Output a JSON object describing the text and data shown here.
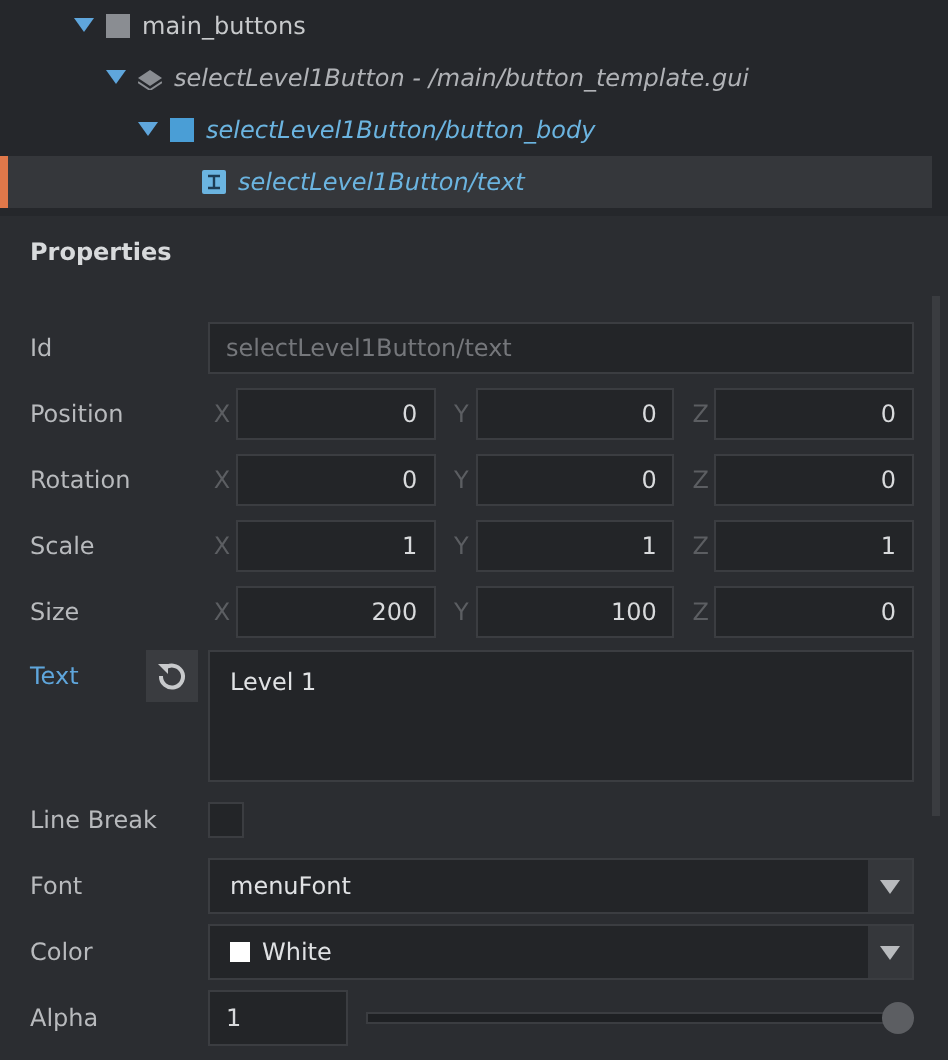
{
  "outline": [
    {
      "label": "main_buttons",
      "kind": "box",
      "expanded": true,
      "selected": false,
      "children": [
        {
          "label": "selectLevel1Button - /main/button_template.gui",
          "kind": "template",
          "expanded": true,
          "selected": false,
          "children": [
            {
              "label": "selectLevel1Button/button_body",
              "kind": "body",
              "expanded": true,
              "selected": false,
              "children": [
                {
                  "label": "selectLevel1Button/text",
                  "kind": "text",
                  "selected": true
                }
              ]
            }
          ]
        }
      ]
    }
  ],
  "properties": {
    "title": "Properties",
    "rows": [
      {
        "kind": "text",
        "label": "Id",
        "value": "selectLevel1Button/text",
        "disabled": true
      },
      {
        "kind": "vec3",
        "label": "Position",
        "axes": [
          {
            "axis": "X",
            "value": "0"
          },
          {
            "axis": "Y",
            "value": "0"
          },
          {
            "axis": "Z",
            "value": "0"
          }
        ]
      },
      {
        "kind": "vec3",
        "label": "Rotation",
        "axes": [
          {
            "axis": "X",
            "value": "0"
          },
          {
            "axis": "Y",
            "value": "0"
          },
          {
            "axis": "Z",
            "value": "0"
          }
        ]
      },
      {
        "kind": "vec3",
        "label": "Scale",
        "axes": [
          {
            "axis": "X",
            "value": "1"
          },
          {
            "axis": "Y",
            "value": "1"
          },
          {
            "axis": "Z",
            "value": "1"
          }
        ]
      },
      {
        "kind": "vec3",
        "label": "Size",
        "axes": [
          {
            "axis": "X",
            "value": "200"
          },
          {
            "axis": "Y",
            "value": "100"
          },
          {
            "axis": "Z",
            "value": "0"
          }
        ]
      },
      {
        "kind": "textarea",
        "label": "Text",
        "value": "Level 1",
        "overridden": true
      },
      {
        "kind": "checkbox",
        "label": "Line Break",
        "checked": false
      },
      {
        "kind": "dropdown",
        "label": "Font",
        "value": "menuFont"
      },
      {
        "kind": "dropdown",
        "label": "Color",
        "value": "White",
        "color": "#ffffff"
      },
      {
        "kind": "slider",
        "label": "Alpha",
        "value": "1",
        "level": 1
      }
    ]
  }
}
